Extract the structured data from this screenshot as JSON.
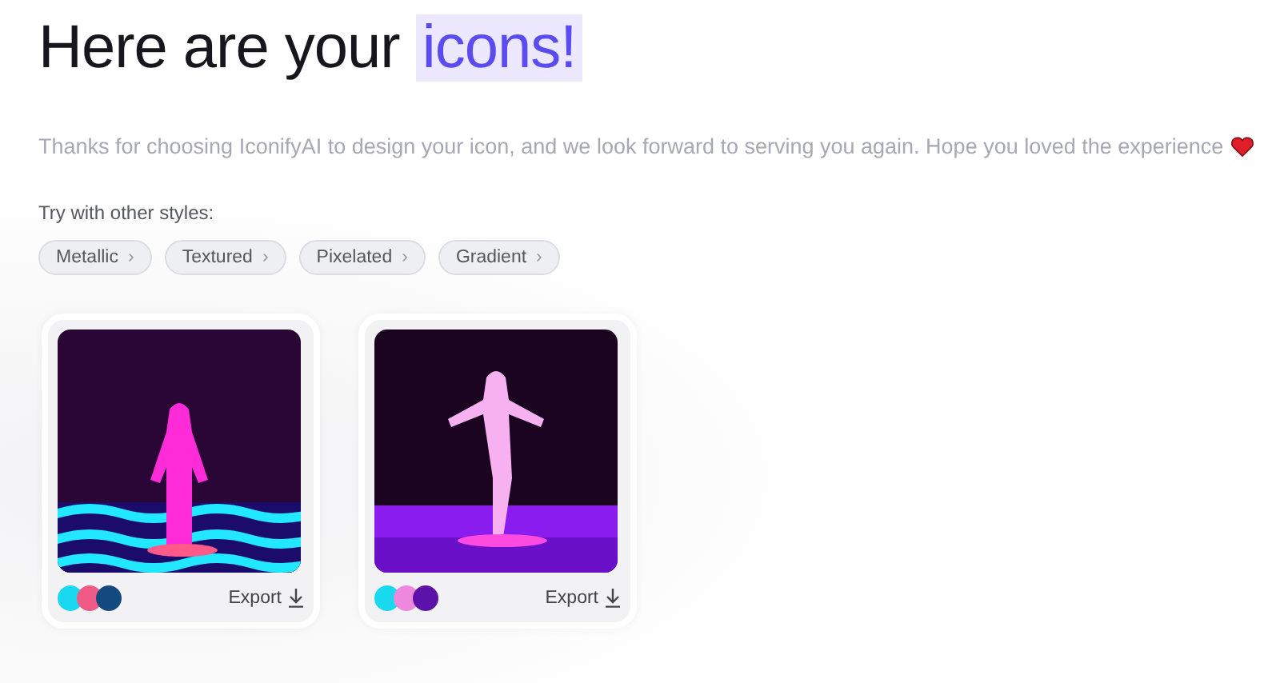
{
  "heading": {
    "text": "Here are your",
    "highlight": "icons!"
  },
  "message": "Thanks for choosing IconifyAI to design your icon, and we look forward to serving you again. Hope you loved the experience",
  "styles_label": "Try with other styles:",
  "styles": [
    {
      "label": "Metallic",
      "arrow": "›"
    },
    {
      "label": "Textured",
      "arrow": "›"
    },
    {
      "label": "Pixelated",
      "arrow": "›"
    },
    {
      "label": "Gradient",
      "arrow": "›"
    }
  ],
  "icons": [
    {
      "kind": "picture",
      "palette": [
        {
          "color": "#19d9f0"
        },
        {
          "color": "#ef5a86"
        },
        {
          "color": "#144a80"
        }
      ],
      "export": "Export"
    },
    {
      "kind": "picture",
      "palette": [
        {
          "color": "#19d9f0"
        },
        {
          "color": "#ee88dd"
        },
        {
          "color": "#5b12a8"
        }
      ],
      "export": "Export"
    }
  ]
}
